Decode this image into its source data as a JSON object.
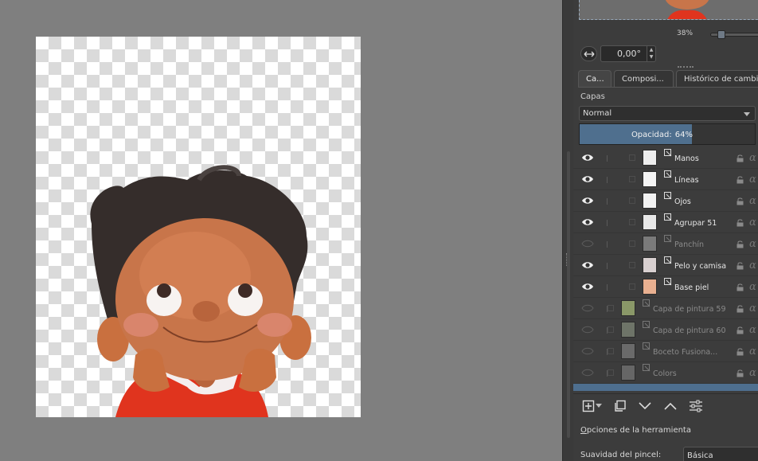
{
  "overview": {
    "zoom": "38%",
    "zoom_fraction": 0.38
  },
  "rotation": {
    "value": "0,00°"
  },
  "tabs": [
    {
      "label": "Ca..."
    },
    {
      "label": "Composi..."
    },
    {
      "label": "Histórico de cambios"
    }
  ],
  "layers_panel": {
    "title": "Capas",
    "blend_mode": "Normal",
    "opacity_label": "Opacidad:",
    "opacity_value": "64%",
    "opacity_fraction": 0.64,
    "layers": [
      {
        "name": "Manos",
        "visible": true
      },
      {
        "name": "Líneas",
        "visible": true
      },
      {
        "name": "Ojos",
        "visible": true
      },
      {
        "name": "Agrupar 51",
        "visible": true
      },
      {
        "name": "Panchín",
        "visible": false
      },
      {
        "name": "Pelo y camisa",
        "visible": true
      },
      {
        "name": "Base piel",
        "visible": true
      },
      {
        "name": "Capa de pintura 59",
        "visible": false
      },
      {
        "name": "Capa de pintura 60",
        "visible": false
      },
      {
        "name": "Boceto Fusiona...",
        "visible": false
      },
      {
        "name": "Colors",
        "visible": false
      }
    ]
  },
  "tool_options": {
    "title": "Opciones de la herramienta",
    "title_underlined_char": "O",
    "title_rest": "pciones de la herramienta",
    "smoothing_label": "Suavidad del pincel:",
    "smoothing_value": "Básica"
  },
  "colors": {
    "accent": "#4f6f8e",
    "panel": "#3c3c3c",
    "canvas_bg": "#7f7f7f"
  }
}
